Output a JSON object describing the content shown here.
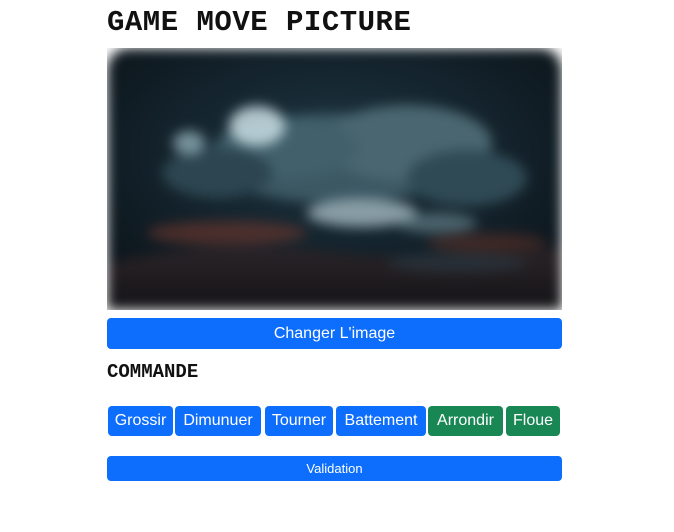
{
  "page": {
    "title": "GAME MOVE PICTURE"
  },
  "picture": {
    "alt": "Night sky clouds image",
    "colors": {
      "sky_dark": "#0b1218",
      "sky_mid": "#1d3542",
      "cloud": "#4a6670",
      "moon": "#c9dde3",
      "horizon_glow": "#7a3a2e",
      "ground": "#1a1a1e"
    }
  },
  "buttons": {
    "change_image": "Changer L'image",
    "validation": "Validation"
  },
  "commands": {
    "heading": "COMMANDE",
    "items": [
      {
        "label": "Grossir",
        "color": "#0d6efd"
      },
      {
        "label": "Dimunuer",
        "color": "#0d6efd"
      },
      {
        "label": "Tourner",
        "color": "#0d6efd"
      },
      {
        "label": "Battement",
        "color": "#0d6efd"
      },
      {
        "label": "Arrondir",
        "color": "#198754"
      },
      {
        "label": "Floue",
        "color": "#198754"
      }
    ]
  }
}
